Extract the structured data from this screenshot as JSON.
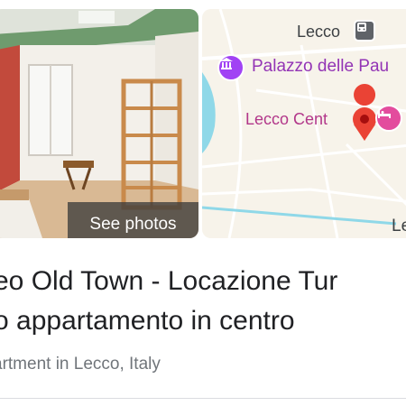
{
  "photo_card": {
    "see_photos_label": "See photos"
  },
  "map_card": {
    "city_label": "Lecco",
    "poi_palazzo_label": "Palazzo delle Pau",
    "poi_centro_label": "Lecco Cent",
    "edge_label": "Le",
    "icons": {
      "train": "train-icon",
      "museum": "museum-icon",
      "hotel": "hotel-icon",
      "location_pin": "location-pin-icon"
    },
    "colors": {
      "museum_pin": "#a142f4",
      "hotel_pin": "#e34c9d",
      "location_pin": "#ea4335",
      "water": "#8fd8e8",
      "road": "#ffffff",
      "highlight_road": "#8fd8e8"
    }
  },
  "listing": {
    "title_line1": "eo Old Town - Locazione Tur",
    "title_line2": "o appartamento in centro",
    "subtitle": "artment in Lecco, Italy"
  }
}
